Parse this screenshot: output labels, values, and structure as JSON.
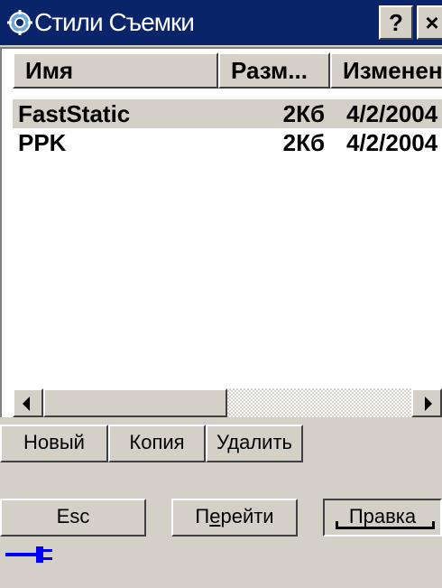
{
  "window": {
    "title": "Стили Съемки",
    "help_label": "?",
    "close_label": "×"
  },
  "listview": {
    "columns": [
      "Имя",
      "Разм...",
      "Изменен"
    ],
    "rows": [
      {
        "name": "FastStatic",
        "size": "2Кб",
        "modified": "4/2/2004",
        "selected": true
      },
      {
        "name": "PPK",
        "size": "2Кб",
        "modified": "4/2/2004",
        "selected": false
      }
    ]
  },
  "actions": {
    "new_label": "Новый",
    "copy_label": "Копия",
    "delete_label": "Удалить"
  },
  "softkeys": {
    "esc_label": "Esc",
    "go_prefix": "П",
    "go_underlined": "е",
    "go_suffix": "рейти",
    "edit_label": "Правка"
  },
  "icons": {
    "title_icon": "gear-globe-icon",
    "status_icon": "power-plug-icon"
  },
  "colors": {
    "titlebar": "#0a246a",
    "face": "#d4d0c8",
    "plug": "#0000ff"
  }
}
